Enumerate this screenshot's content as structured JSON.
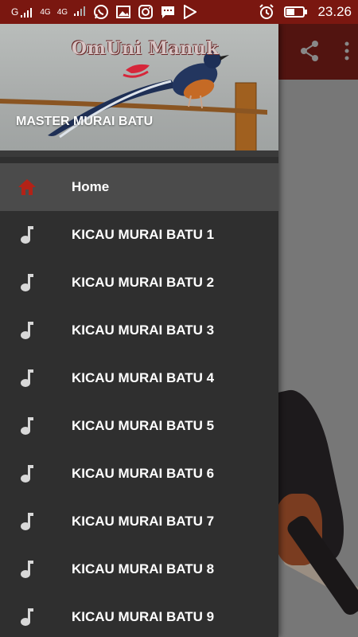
{
  "status_bar": {
    "carrier_left": "G",
    "network_1": "4G",
    "network_2": "4G",
    "time": "23.26",
    "icons": [
      "whatsapp-icon",
      "gallery-icon",
      "instagram-icon",
      "message-icon",
      "play-store-icon",
      "alarm-icon",
      "battery-icon"
    ]
  },
  "app": {
    "toolbar_color": "#521410",
    "actions": [
      "share-icon",
      "overflow-menu-icon"
    ]
  },
  "drawer": {
    "header": {
      "logo_text": "OmUni Manuk",
      "title": "MASTER MURAI BATU"
    },
    "items": [
      {
        "label": "Home",
        "icon": "home-icon",
        "selected": true
      },
      {
        "label": "KICAU MURAI BATU 1",
        "icon": "music-note-icon"
      },
      {
        "label": "KICAU MURAI BATU 2",
        "icon": "music-note-icon"
      },
      {
        "label": "KICAU MURAI BATU 3",
        "icon": "music-note-icon"
      },
      {
        "label": "KICAU MURAI BATU 4",
        "icon": "music-note-icon"
      },
      {
        "label": "KICAU MURAI BATU 5",
        "icon": "music-note-icon"
      },
      {
        "label": "KICAU MURAI BATU 6",
        "icon": "music-note-icon"
      },
      {
        "label": "KICAU MURAI BATU 7",
        "icon": "music-note-icon"
      },
      {
        "label": "KICAU MURAI BATU 8",
        "icon": "music-note-icon"
      },
      {
        "label": "KICAU MURAI BATU 9",
        "icon": "music-note-icon"
      }
    ]
  },
  "colors": {
    "status_bar": "#7a1710",
    "drawer_bg": "#2f2f2f",
    "selected_item_bg": "#4b4b4b",
    "home_icon": "#b32217",
    "note_icon": "#d8d8d8"
  }
}
